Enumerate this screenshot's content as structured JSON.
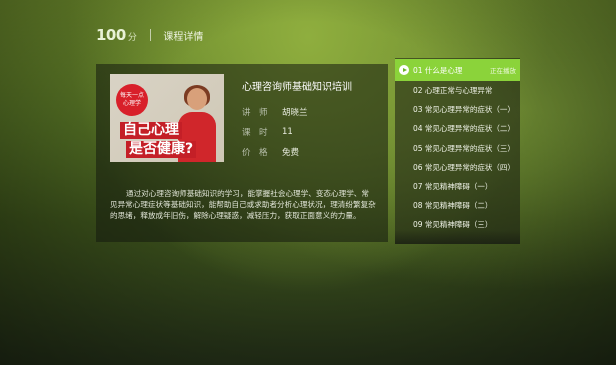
{
  "header": {
    "logo": "100",
    "logo_sub": "分",
    "breadcrumb": "课程详情"
  },
  "course": {
    "title": "心理咨询师基础知识培训",
    "poster": {
      "badge": "每天一点心理学",
      "line1": "自己心理",
      "line2": "是否健康?"
    },
    "meta": [
      {
        "key": "讲　师",
        "value": "胡晓兰"
      },
      {
        "key": "课　时",
        "value": "11"
      },
      {
        "key": "价　格",
        "value": "免费"
      }
    ],
    "description": "通过对心理咨询师基础知识的学习，能掌握社会心理学、变态心理学、常见异常心理症状等基础知识，能帮助自己或求助者分析心理状况，理清纷繁复杂的思绪，释放成年旧伤，解除心理疑惑，减轻压力，获取正面意义的力量。"
  },
  "episodes": [
    {
      "label": "01 什么是心理",
      "status": "正在播放",
      "active": true
    },
    {
      "label": "02 心理正常与心理异常"
    },
    {
      "label": "03 常见心理异常的症状（一）"
    },
    {
      "label": "04 常见心理异常的症状（二）"
    },
    {
      "label": "05 常见心理异常的症状（三）"
    },
    {
      "label": "06 常见心理异常的症状（四）"
    },
    {
      "label": "07 常见精神障碍（一）"
    },
    {
      "label": "08 常见精神障碍（二）"
    },
    {
      "label": "09 常见精神障碍（三）"
    }
  ],
  "colors": {
    "accent": "#8bd33a",
    "poster_red": "#c41f27"
  }
}
